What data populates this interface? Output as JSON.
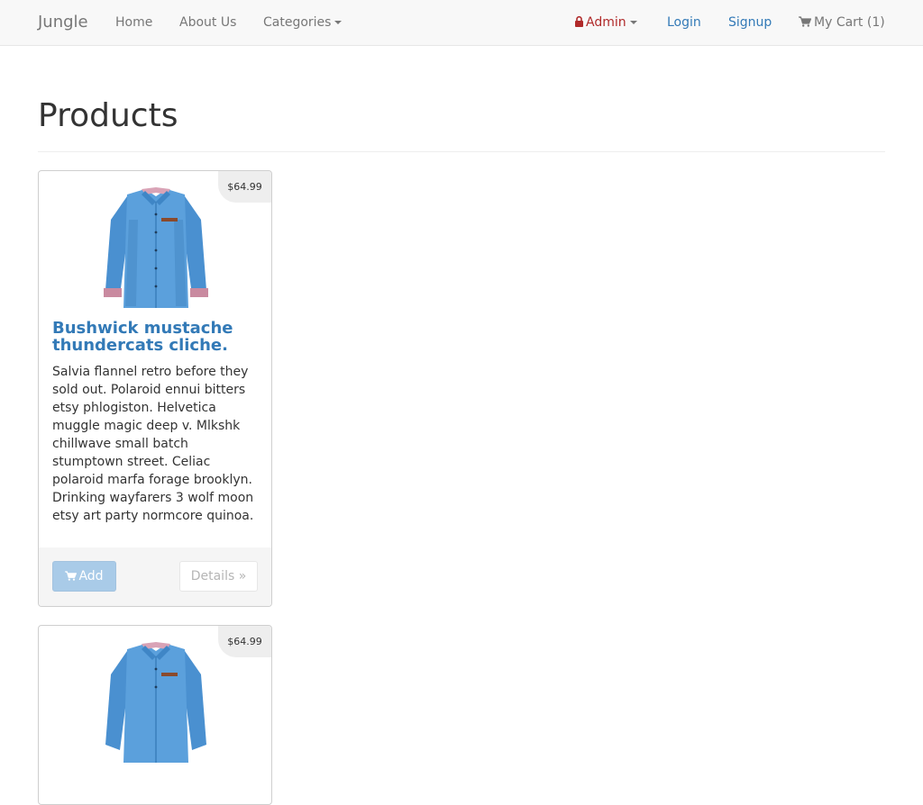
{
  "navbar": {
    "brand": "Jungle",
    "links": {
      "home": "Home",
      "about": "About Us",
      "categories": "Categories",
      "admin": "Admin",
      "login": "Login",
      "signup": "Signup",
      "cart": "My Cart (1)"
    },
    "icons": {
      "admin": "lock-icon",
      "cart": "shopping-cart-icon",
      "categories": "caret-down-icon",
      "admin_caret": "caret-down-icon"
    }
  },
  "page": {
    "title": "Products"
  },
  "products": [
    {
      "price": "$64.99",
      "name": "Bushwick mustache thundercats cliche.",
      "description": "Salvia flannel retro before they sold out. Polaroid ennui bitters etsy phlogiston. Helvetica muggle magic deep v. Mlkshk chillwave small batch stumptown street. Celiac polaroid marfa forage brooklyn. Drinking wayfarers 3 wolf moon etsy art party normcore quinoa.",
      "add_label": "Add",
      "details_label": "Details »",
      "image": "blue-denim-shirt"
    },
    {
      "price": "$64.99",
      "image": "blue-denim-shirt"
    }
  ],
  "colors": {
    "link": "#337ab7",
    "admin": "#b02a2a",
    "navbar_bg": "#f8f8f8",
    "add_button": "#a9cbe8"
  }
}
